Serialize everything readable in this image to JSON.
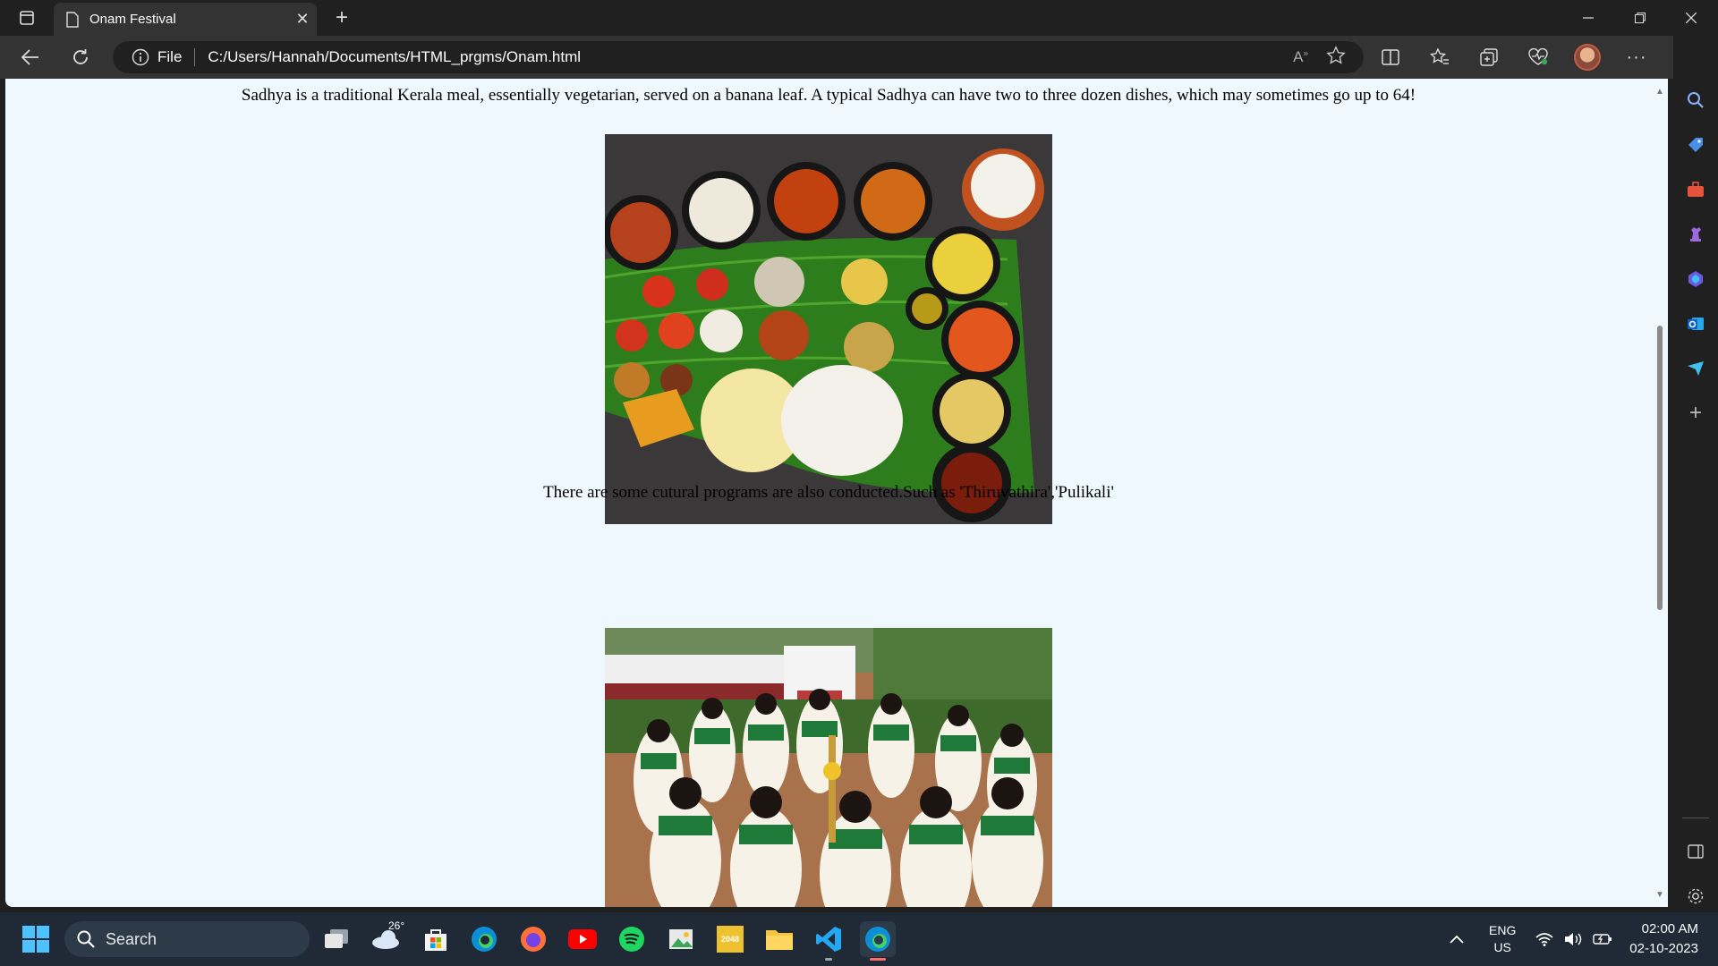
{
  "browser": {
    "tab": {
      "title": "Onam Festival"
    },
    "address": {
      "scheme_label": "File",
      "url": "C:/Users/Hannah/Documents/HTML_prgms/Onam.html"
    },
    "accent": "#0078d4"
  },
  "page": {
    "background": "#f0f8ff",
    "paragraph_sadhya": "Sadhya is a traditional Kerala meal, essentially vegetarian, served on a banana leaf. A typical Sadhya can have two to three dozen dishes, which may sometimes go up to 64!",
    "paragraph_cultural": "There are some cutural programs are also conducted.Such as 'Thiruvathira','Pulikali'",
    "scroll_position_fraction": 0.45
  },
  "taskbar": {
    "search_label": "Search",
    "weather_temp": "26°",
    "game_label": "2048",
    "language_top": "ENG",
    "language_bottom": "US",
    "time": "02:00 AM",
    "date": "02-10-2023"
  }
}
